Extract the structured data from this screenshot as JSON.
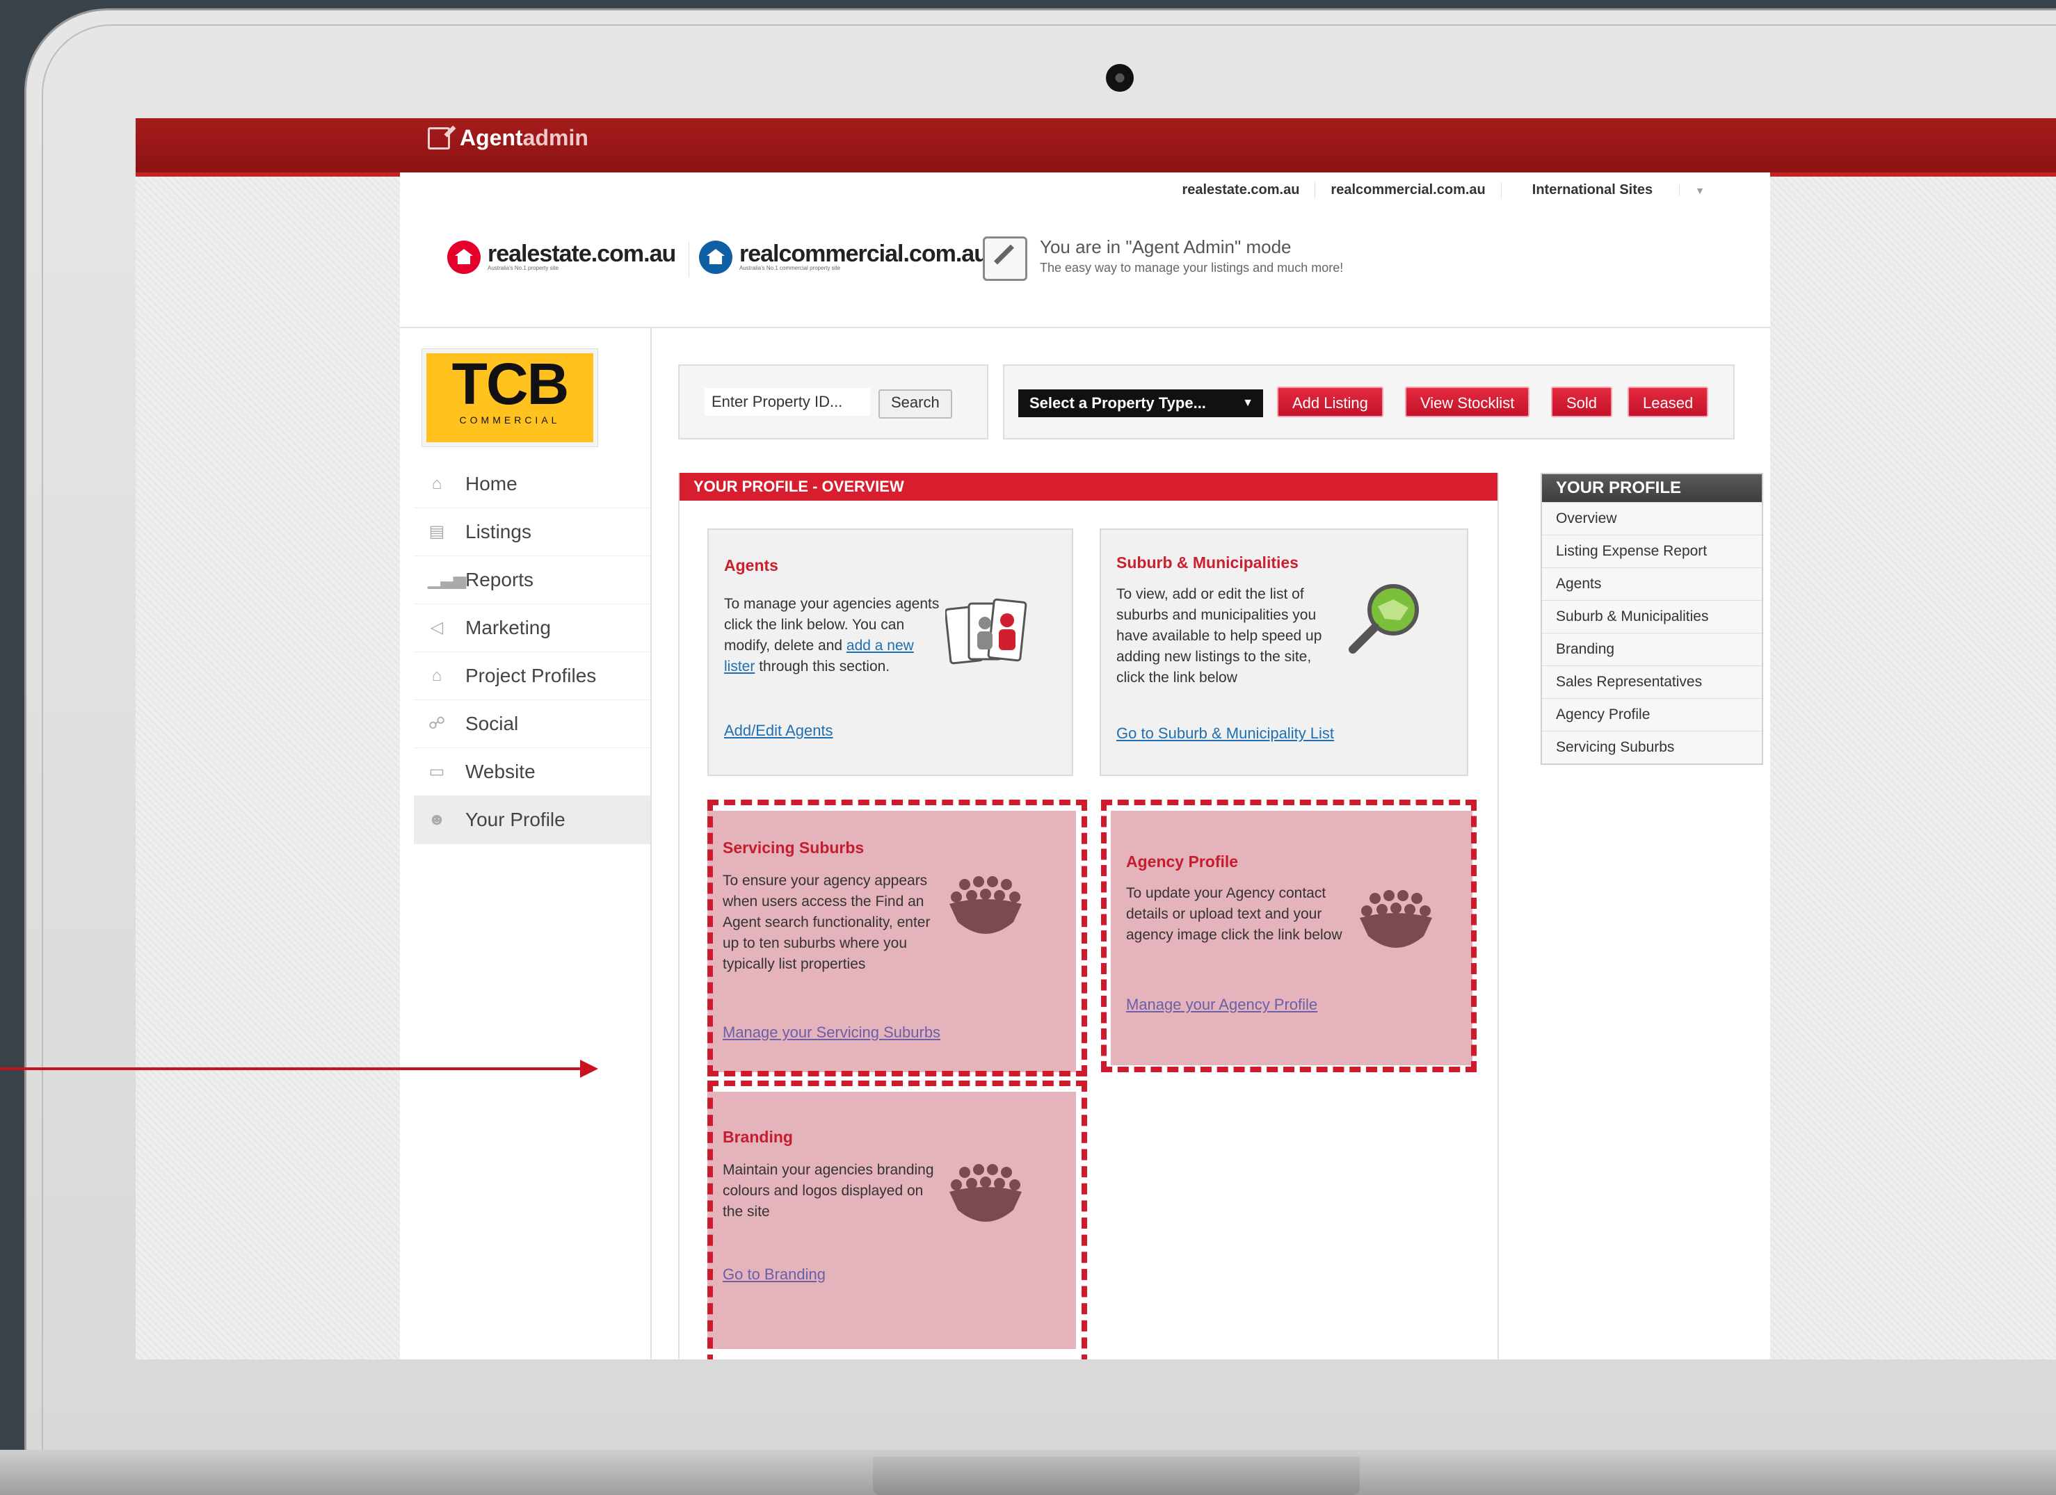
{
  "app": {
    "brand_main": "Agent",
    "brand_sub": "admin"
  },
  "header": {
    "links": [
      "realestate.com.au",
      "realcommercial.com.au",
      "International Sites"
    ],
    "logo_rea": {
      "text": "realestate.com.au",
      "tagline": "Australia's No.1 property site"
    },
    "logo_rc": {
      "text": "realcommercial.com.au",
      "tagline": "Australia's No.1 commercial property site"
    },
    "mode_title": "You are in \"Agent Admin\" mode",
    "mode_sub": "The easy way to manage your listings and much more!"
  },
  "agency_logo": {
    "big": "TCB",
    "small": "COMMERCIAL"
  },
  "sidebar": {
    "items": [
      {
        "label": "Home",
        "icon": "home-icon"
      },
      {
        "label": "Listings",
        "icon": "listings-icon"
      },
      {
        "label": "Reports",
        "icon": "reports-icon"
      },
      {
        "label": "Marketing",
        "icon": "megaphone-icon"
      },
      {
        "label": "Project Profiles",
        "icon": "home-icon"
      },
      {
        "label": "Social",
        "icon": "social-icon"
      },
      {
        "label": "Website",
        "icon": "monitor-icon"
      },
      {
        "label": "Your Profile",
        "icon": "users-icon"
      }
    ]
  },
  "toolbar": {
    "property_id_placeholder": "Enter Property ID...",
    "search_label": "Search",
    "property_type": "Select a Property Type...",
    "add_listing": "Add Listing",
    "view_stocklist": "View Stocklist",
    "sold": "Sold",
    "leased": "Leased"
  },
  "overview": {
    "title": "YOUR PROFILE - OVERVIEW",
    "cards": {
      "agents": {
        "title": "Agents",
        "desc_pre": "To manage your agencies agents click the link below. You can modify, delete and",
        "desc_link": "add a new lister",
        "desc_post": "through this section.",
        "link": "Add/Edit Agents"
      },
      "suburb": {
        "title": "Suburb & Municipalities",
        "desc": "To view, add or edit the list of suburbs and municipalities you have available to help speed up adding new listings to the site, click the link below",
        "link": "Go to Suburb & Municipality List"
      },
      "servicing": {
        "title": "Servicing Suburbs",
        "desc": "To ensure your agency appears when users access the Find an Agent search functionality, enter up to ten suburbs where you typically list properties",
        "link": "Manage your Servicing Suburbs"
      },
      "agency_profile": {
        "title": "Agency Profile",
        "desc": "To update your Agency contact details or upload text and your agency image click the link below",
        "link": "Manage your Agency Profile"
      },
      "branding": {
        "title": "Branding",
        "desc": "Maintain your agencies branding colours and logos displayed on the site",
        "link": "Go to Branding"
      }
    }
  },
  "profile_menu": {
    "title": "YOUR PROFILE",
    "items": [
      "Overview",
      "Listing Expense Report",
      "Agents",
      "Suburb & Municipalities",
      "Branding",
      "Sales Representatives",
      "Agency Profile",
      "Servicing Suburbs"
    ]
  },
  "colors": {
    "brand_red": "#a61c1c",
    "accent_red": "#d81e2e",
    "highlight": "#e4b3bb",
    "tcb_yellow": "#ffc21f"
  }
}
